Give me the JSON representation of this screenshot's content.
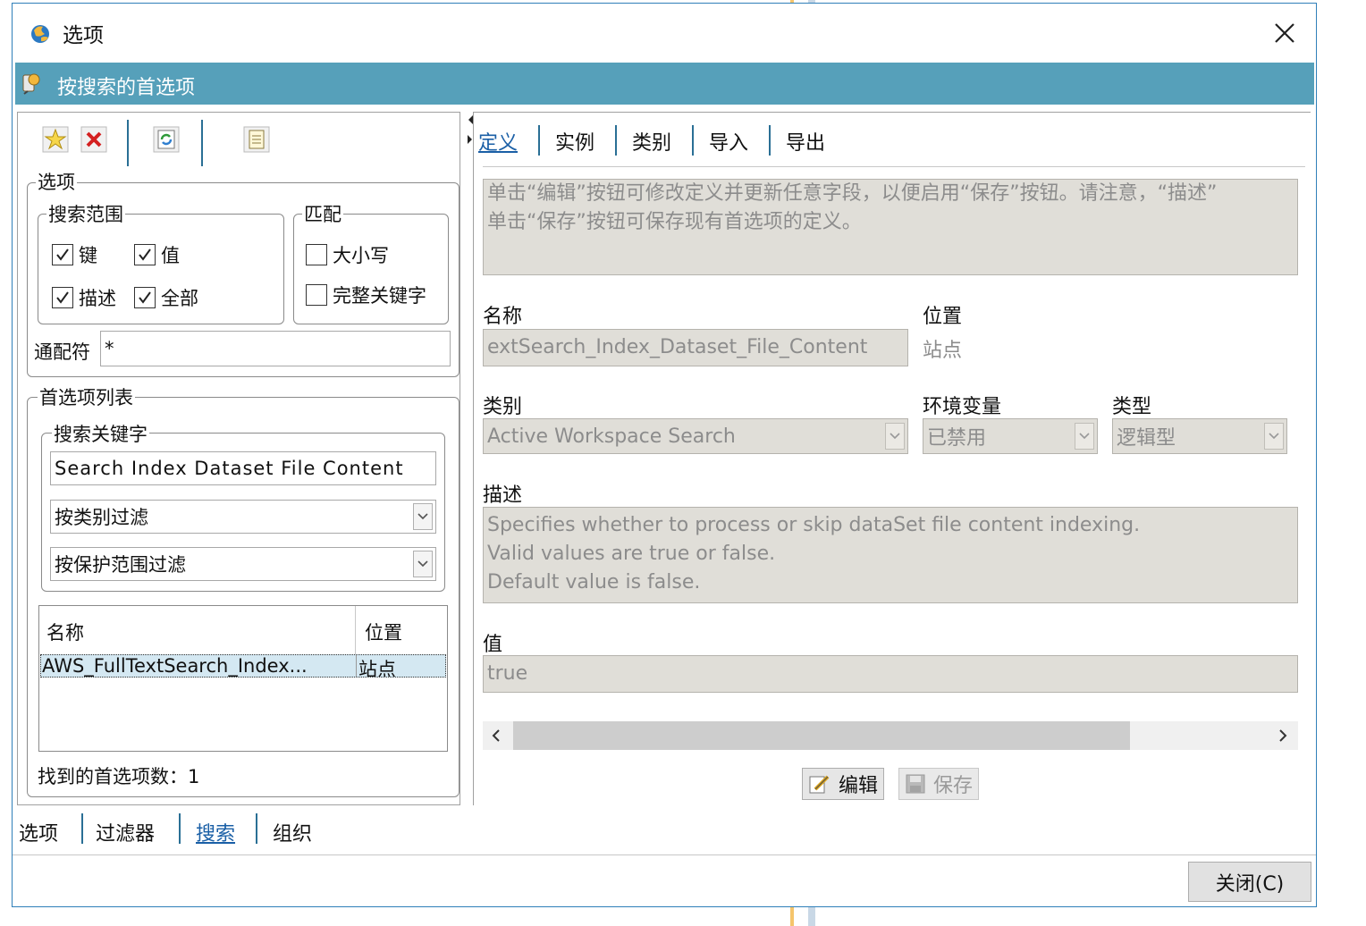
{
  "window": {
    "title": "选项",
    "close_icon": "close-icon"
  },
  "header": {
    "title": "按搜索的首选项"
  },
  "toolbar": {
    "icons": [
      "new-star-icon",
      "delete-x-icon",
      "refresh-icon",
      "report-icon"
    ]
  },
  "options_group": {
    "legend": "选项",
    "scope": {
      "legend": "搜索范围",
      "items": [
        {
          "label": "键",
          "checked": true
        },
        {
          "label": "值",
          "checked": true
        },
        {
          "label": "描述",
          "checked": true
        },
        {
          "label": "全部",
          "checked": true
        }
      ]
    },
    "match": {
      "legend": "匹配",
      "items": [
        {
          "label": "大小写",
          "checked": false
        },
        {
          "label": "完整关键字",
          "checked": false
        }
      ]
    },
    "wildcard": {
      "label": "通配符",
      "value": "*"
    }
  },
  "pref_list": {
    "legend": "首选项列表",
    "search_keyword": {
      "legend": "搜索关键字",
      "value": "Search Index Dataset File Content"
    },
    "filter_category": "按类别过滤",
    "filter_protection": "按保护范围过滤",
    "columns": [
      "名称",
      "位置"
    ],
    "rows": [
      {
        "name": "AWS_FullTextSearch_Index...",
        "location": "站点"
      }
    ],
    "found_count": "找到的首选项数：1"
  },
  "left_tabs": [
    {
      "label": "选项",
      "active": false
    },
    {
      "label": "过滤器",
      "active": false
    },
    {
      "label": "搜索",
      "active": true
    },
    {
      "label": "组织",
      "active": false
    }
  ],
  "right_tabs": [
    {
      "label": "定义",
      "active": true
    },
    {
      "label": "实例",
      "active": false
    },
    {
      "label": "类别",
      "active": false
    },
    {
      "label": "导入",
      "active": false
    },
    {
      "label": "导出",
      "active": false
    }
  ],
  "definition": {
    "info_lines": [
      "单击“编辑”按钮可修改定义并更新任意字段，以便启用“保存”按钮。请注意，“描述”",
      "单击“保存”按钮可保存现有首选项的定义。"
    ],
    "name": {
      "label": "名称",
      "value": "extSearch_Index_Dataset_File_Content"
    },
    "location": {
      "label": "位置",
      "value": "站点"
    },
    "category": {
      "label": "类别",
      "value": "Active Workspace Search"
    },
    "env_var": {
      "label": "环境变量",
      "value": "已禁用"
    },
    "type": {
      "label": "类型",
      "value": "逻辑型"
    },
    "description": {
      "label": "描述",
      "lines": [
        "Specifies whether to process or skip dataSet file content indexing.",
        "Valid values are true or false.",
        "Default value is false."
      ]
    },
    "value": {
      "label": "值",
      "value": "true"
    }
  },
  "actions": {
    "edit": "编辑",
    "save": "保存"
  },
  "close_button": "关闭(C)",
  "colors": {
    "header_band": "#56a0ba",
    "link": "#1a5fa6",
    "selected_row": "#d4e8f2",
    "readonly_bg": "#e0ded8"
  }
}
